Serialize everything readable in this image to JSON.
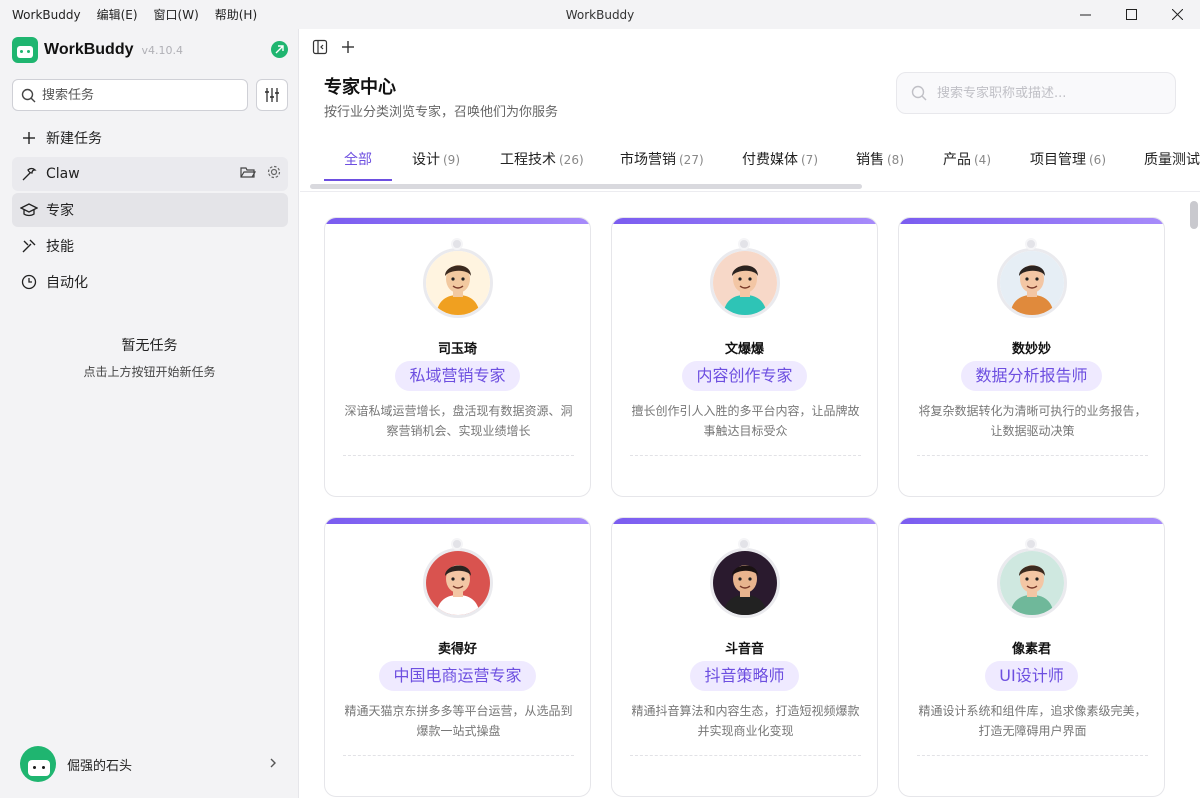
{
  "app": {
    "window_title": "WorkBuddy",
    "menus": [
      "WorkBuddy",
      "编辑(E)",
      "窗口(W)",
      "帮助(H)"
    ]
  },
  "sidebar": {
    "brand": "WorkBuddy",
    "version": "v4.10.4",
    "search_placeholder": "搜索任务",
    "items": [
      {
        "label": "新建任务",
        "icon": "plus-icon"
      },
      {
        "label": "Claw",
        "icon": "claw-icon"
      },
      {
        "label": "专家",
        "icon": "graduation-cap-icon"
      },
      {
        "label": "技能",
        "icon": "tools-icon"
      },
      {
        "label": "自动化",
        "icon": "clock-icon"
      }
    ],
    "empty_title": "暂无任务",
    "empty_subtitle": "点击上方按钮开始新任务",
    "user_name": "倔强的石头"
  },
  "main": {
    "title": "专家中心",
    "subtitle": "按行业分类浏览专家，召唤他们为你服务",
    "search_placeholder": "搜索专家职称或描述...",
    "tabs": [
      {
        "label": "全部",
        "count": ""
      },
      {
        "label": "设计",
        "count": "(9)"
      },
      {
        "label": "工程技术",
        "count": "(26)"
      },
      {
        "label": "市场营销",
        "count": "(27)"
      },
      {
        "label": "付费媒体",
        "count": "(7)"
      },
      {
        "label": "销售",
        "count": "(8)"
      },
      {
        "label": "产品",
        "count": "(4)"
      },
      {
        "label": "项目管理",
        "count": "(6)"
      },
      {
        "label": "质量测试",
        "count": ""
      }
    ],
    "experts": [
      {
        "name": "司玉琦",
        "role": "私域营销专家",
        "desc": "深谙私域运营增长，盘活现有数据资源、洞察营销机会、实现业绩增长",
        "bg": "#fff4e0",
        "skin": "#f2c9a0",
        "hair": "#3b2a1f",
        "shirt": "#f0a020"
      },
      {
        "name": "文爆爆",
        "role": "内容创作专家",
        "desc": "擅长创作引人入胜的多平台内容，让品牌故事触达目标受众",
        "bg": "#f7d8c8",
        "skin": "#f3c6a4",
        "hair": "#2b2320",
        "shirt": "#2ec4b6"
      },
      {
        "name": "数妙妙",
        "role": "数据分析报告师",
        "desc": "将复杂数据转化为清晰可执行的业务报告，让数据驱动决策",
        "bg": "#e6eef5",
        "skin": "#f3c6a4",
        "hair": "#2b2320",
        "shirt": "#e08a3c"
      },
      {
        "name": "卖得好",
        "role": "中国电商运营专家",
        "desc": "精通天猫京东拼多多等平台运营，从选品到爆款一站式操盘",
        "bg": "#d9534f",
        "skin": "#f3c6a4",
        "hair": "#2b2320",
        "shirt": "#ffffff"
      },
      {
        "name": "斗音音",
        "role": "抖音策略师",
        "desc": "精通抖音算法和内容生态，打造短视频爆款并实现商业化变现",
        "bg": "#2a1a2e",
        "skin": "#e8b48e",
        "hair": "#1a1212",
        "shirt": "#222222"
      },
      {
        "name": "像素君",
        "role": "UI设计师",
        "desc": "精通设计系统和组件库，追求像素级完美，打造无障碍用户界面",
        "bg": "#cfe8e0",
        "skin": "#f3c6a4",
        "hair": "#3b2a1f",
        "shirt": "#6fb89a"
      }
    ]
  }
}
